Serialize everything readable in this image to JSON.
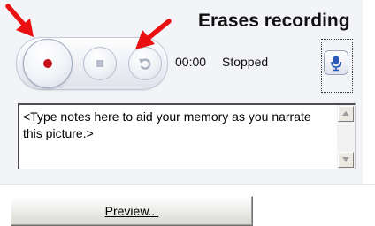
{
  "annotation": {
    "title": "Erases recording"
  },
  "recorder": {
    "time": "00:00",
    "status": "Stopped"
  },
  "notes": {
    "placeholder": "<Type notes here to aid your memory as you narrate this picture.>"
  },
  "actions": {
    "preview_label": "Preview..."
  },
  "colors": {
    "record_dot": "#c8101a",
    "arrow": "#e81010",
    "mic": "#2a57b8"
  },
  "icons": {
    "record": "record-dot-icon",
    "stop": "stop-square-icon",
    "undo": "undo-arrow-icon",
    "mic": "microphone-icon",
    "scroll_up": "chevron-up-icon",
    "scroll_down": "chevron-down-icon"
  }
}
